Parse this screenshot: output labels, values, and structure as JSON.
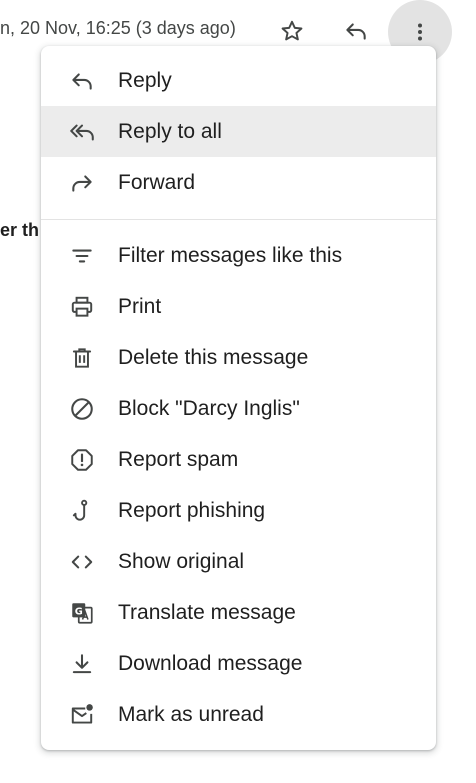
{
  "header": {
    "date_text": "n, 20 Nov, 16:25 (3 days ago)",
    "star_icon": "star-outline-icon",
    "reply_icon": "reply-icon",
    "more_icon": "more-vert-icon"
  },
  "body_fragment": "er th",
  "menu": {
    "group1": [
      {
        "label": "Reply",
        "icon": "reply-icon"
      },
      {
        "label": "Reply to all",
        "icon": "reply-all-icon"
      },
      {
        "label": "Forward",
        "icon": "forward-icon"
      }
    ],
    "group2": [
      {
        "label": "Filter messages like this",
        "icon": "filter-icon"
      },
      {
        "label": "Print",
        "icon": "print-icon"
      },
      {
        "label": "Delete this message",
        "icon": "delete-icon"
      },
      {
        "label": "Block \"Darcy Inglis\"",
        "icon": "block-icon"
      },
      {
        "label": "Report spam",
        "icon": "report-spam-icon"
      },
      {
        "label": "Report phishing",
        "icon": "phishing-hook-icon"
      },
      {
        "label": "Show original",
        "icon": "code-icon"
      },
      {
        "label": "Translate message",
        "icon": "translate-icon"
      },
      {
        "label": "Download message",
        "icon": "download-icon"
      },
      {
        "label": "Mark as unread",
        "icon": "mark-unread-icon"
      }
    ]
  },
  "colors": {
    "icon": "#444746",
    "hover_row": "#ececec",
    "more_button_bg": "#e3e3e3"
  }
}
